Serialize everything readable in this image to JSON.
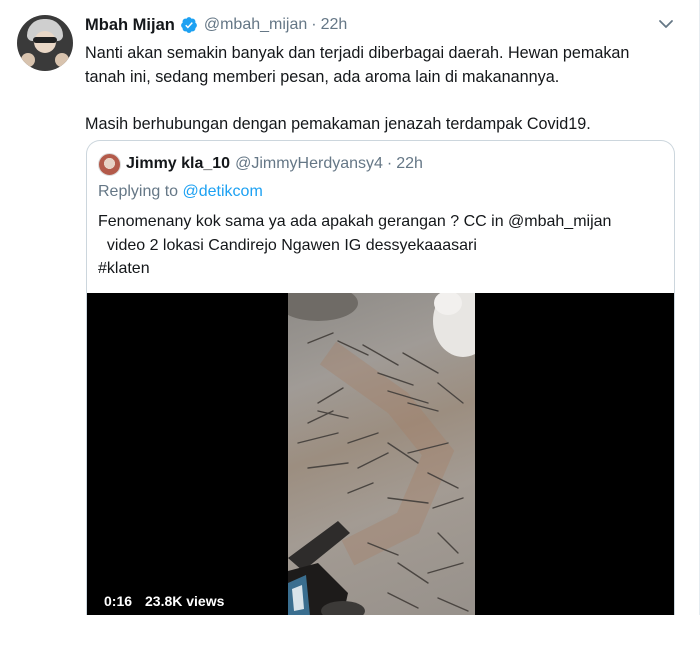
{
  "tweet": {
    "name": "Mbah Mijan",
    "handle": "@mbah_mijan",
    "separator": "·",
    "time": "22h",
    "text_line1": "Nanti akan semakin banyak dan terjadi diberbagai daerah. Hewan pemakan",
    "text_line2": "tanah ini, sedang memberi pesan, ada aroma lain di makanannya.",
    "text_para2": "Masih berhubungan dengan pemakaman jenazah terdampak Covid19.",
    "verified_icon": "verified-badge-icon",
    "menu_icon": "chevron-down-icon",
    "colors": {
      "verified": "#1da1f2",
      "secondary": "#657786",
      "link": "#1da1f2"
    }
  },
  "quote": {
    "name": "Jimmy kla_10",
    "handle": "@JimmyHerdyansy4",
    "separator": "·",
    "time": "22h",
    "replying_prefix": "Replying to ",
    "replying_to": "@detikcom",
    "text_line1": "Fenomenany kok sama ya ada apakah gerangan ? CC in @mbah_mijan",
    "text_line2": "  video 2 lokasi Candirejo Ngawen IG dessyekaaasari",
    "text_line3": "#klaten",
    "video": {
      "duration": "0:16",
      "views": "23.8K views"
    }
  }
}
